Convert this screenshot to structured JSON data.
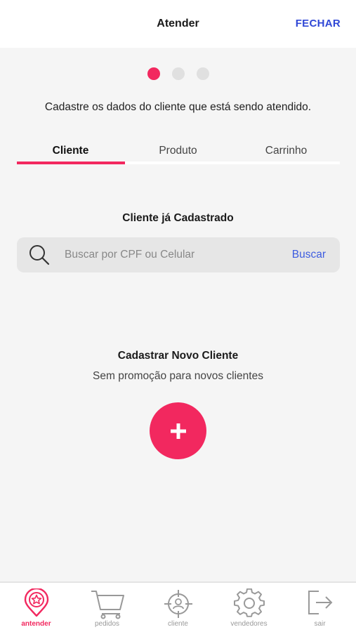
{
  "header": {
    "title": "Atender",
    "close_label": "FECHAR"
  },
  "steps": {
    "count": 3,
    "active": 1
  },
  "subtitle": "Cadastre os dados do cliente que está sendo atendido.",
  "tabs": [
    {
      "label": "Cliente",
      "active": true
    },
    {
      "label": "Produto",
      "active": false
    },
    {
      "label": "Carrinho",
      "active": false
    }
  ],
  "existing_client": {
    "title": "Cliente já Cadastrado",
    "search_placeholder": "Buscar por CPF ou Celular",
    "search_value": "",
    "search_button": "Buscar"
  },
  "new_client": {
    "title": "Cadastrar Novo Cliente",
    "subtitle": "Sem promoção para novos clientes",
    "add_icon": "plus-icon"
  },
  "bottom_nav": [
    {
      "label": "antender",
      "icon": "location-star-icon",
      "active": true
    },
    {
      "label": "pedidos",
      "icon": "cart-icon",
      "active": false
    },
    {
      "label": "cliente",
      "icon": "target-person-icon",
      "active": false
    },
    {
      "label": "vendedores",
      "icon": "gear-icon",
      "active": false
    },
    {
      "label": "sair",
      "icon": "logout-icon",
      "active": false
    }
  ],
  "colors": {
    "accent": "#f2285f",
    "link": "#2f47d6",
    "background": "#f5f5f5"
  }
}
